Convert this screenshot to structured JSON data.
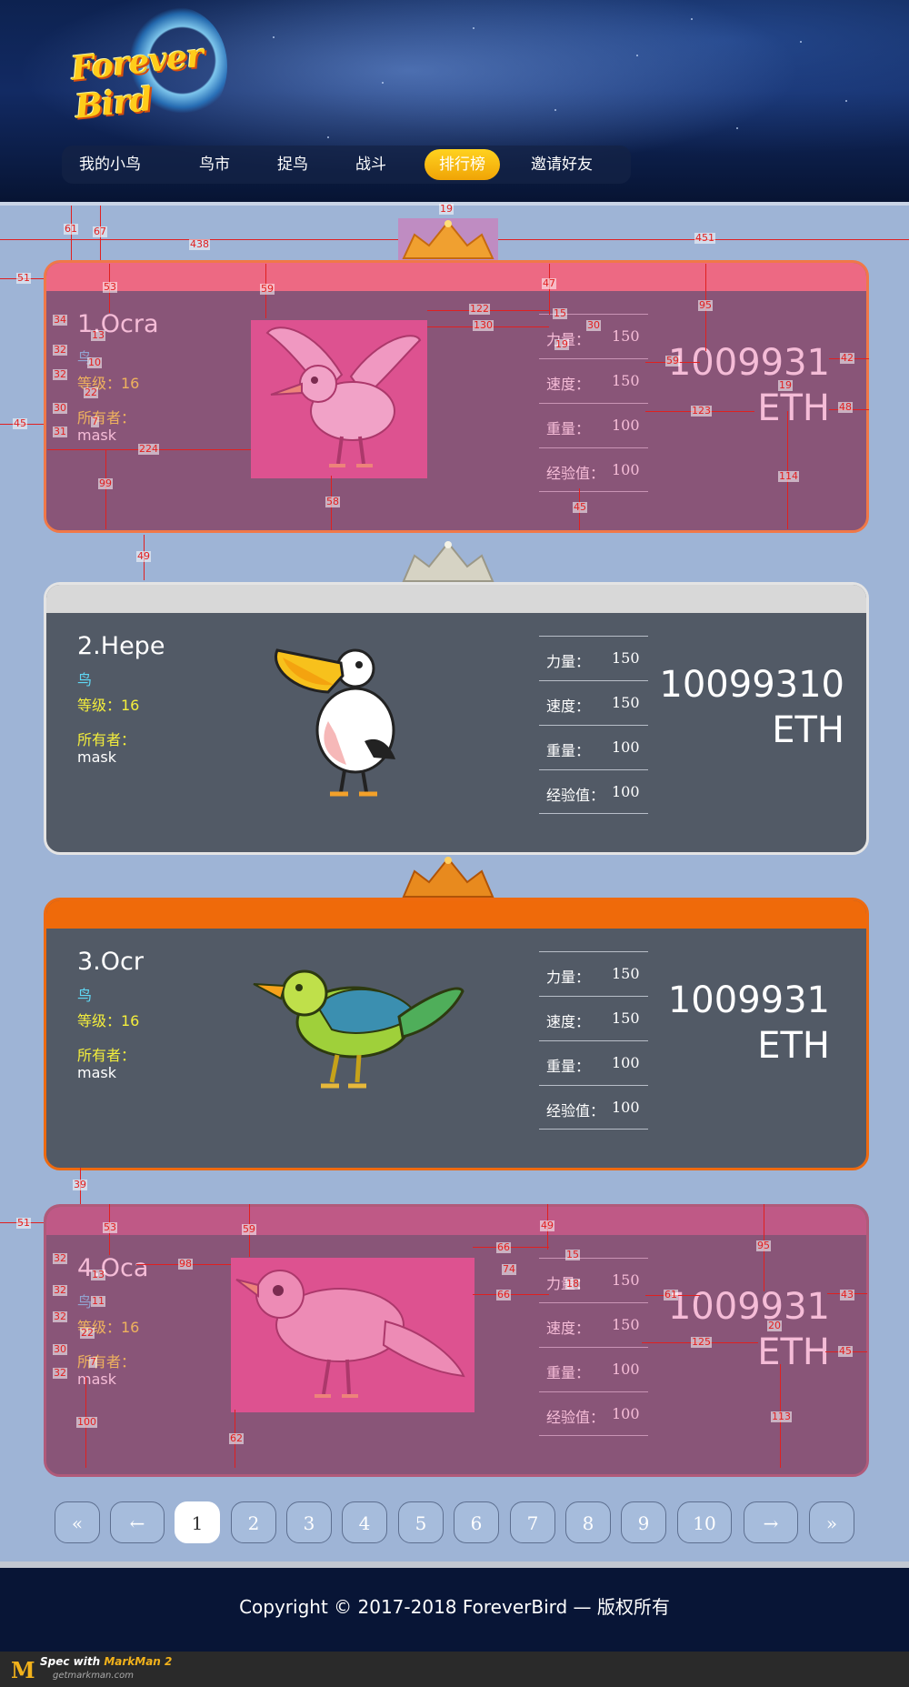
{
  "logo": {
    "text": "Forever Bird"
  },
  "nav": {
    "items": [
      {
        "label": "我的小鸟",
        "active": false
      },
      {
        "label": "鸟市",
        "active": false
      },
      {
        "label": "捉鸟",
        "active": false
      },
      {
        "label": "战斗",
        "active": false
      },
      {
        "label": "排行榜",
        "active": true
      },
      {
        "label": "邀请好友",
        "active": false
      }
    ]
  },
  "ranking": [
    {
      "rank_name": "1.Ocra",
      "kind": "鸟",
      "level": "等级：16",
      "owner_label": "所有者：",
      "owner": "mask",
      "stats": [
        {
          "label": "力量：",
          "value": "150"
        },
        {
          "label": "速度：",
          "value": "150"
        },
        {
          "label": "重量：",
          "value": "100"
        },
        {
          "label": "经验值：",
          "value": "100"
        }
      ],
      "price": "1009931",
      "unit": "ETH",
      "crown": "gold",
      "accent": "#f27a78",
      "bird_icon": "seagull-icon"
    },
    {
      "rank_name": "2.Hepe",
      "kind": "鸟",
      "level": "等级：16",
      "owner_label": "所有者：",
      "owner": "mask",
      "stats": [
        {
          "label": "力量：",
          "value": "150"
        },
        {
          "label": "速度：",
          "value": "150"
        },
        {
          "label": "重量：",
          "value": "100"
        },
        {
          "label": "经验值：",
          "value": "100"
        }
      ],
      "price": "10099310",
      "unit": "ETH",
      "crown": "silver",
      "accent": "#d8d8d8",
      "bird_icon": "pelican-icon"
    },
    {
      "rank_name": "3.Ocr",
      "kind": "鸟",
      "level": "等级：16",
      "owner_label": "所有者：",
      "owner": "mask",
      "stats": [
        {
          "label": "力量：",
          "value": "150"
        },
        {
          "label": "速度：",
          "value": "150"
        },
        {
          "label": "重量：",
          "value": "100"
        },
        {
          "label": "经验值：",
          "value": "100"
        }
      ],
      "price": "1009931",
      "unit": "ETH",
      "crown": "bronze",
      "accent": "#ef6a0a",
      "bird_icon": "green-bird-icon"
    },
    {
      "rank_name": "4.Oca",
      "kind": "鸟",
      "level": "等级：16",
      "owner_label": "所有者：",
      "owner": "mask",
      "stats": [
        {
          "label": "力量：",
          "value": "150"
        },
        {
          "label": "速度：",
          "value": "150"
        },
        {
          "label": "重量：",
          "value": "100"
        },
        {
          "label": "经验值：",
          "value": "100"
        }
      ],
      "price": "1009931",
      "unit": "ETH",
      "crown": "none",
      "accent": "#a8607c",
      "bird_icon": "sparrow-icon"
    }
  ],
  "pagination": {
    "first": "«",
    "prev": "←",
    "pages": [
      "1",
      "2",
      "3",
      "4",
      "5",
      "6",
      "7",
      "8",
      "9",
      "10"
    ],
    "current": "1",
    "next": "→",
    "last": "»"
  },
  "footer": {
    "copyright": "Copyright © 2017-2018 ForeverBird — 版权所有"
  },
  "markman": {
    "prefix": "Spec with",
    "brand": "MarkMan 2",
    "url": "getmarkman.com"
  },
  "measurements": {
    "card1": [
      "19",
      "61",
      "67",
      "438",
      "451",
      "51",
      "53",
      "59",
      "47",
      "95",
      "34",
      "13",
      "122",
      "15",
      "130",
      "30",
      "32",
      "10",
      "19",
      "32",
      "22",
      "59",
      "42",
      "45",
      "30",
      "7",
      "19",
      "31",
      "123",
      "48",
      "224",
      "99",
      "58",
      "45",
      "114"
    ],
    "between": [
      "49",
      "39"
    ],
    "card4": [
      "51",
      "53",
      "59",
      "49",
      "95",
      "32",
      "98",
      "13",
      "66",
      "15",
      "32",
      "11",
      "74",
      "18",
      "61",
      "43",
      "32",
      "22",
      "66",
      "20",
      "30",
      "7",
      "125",
      "45",
      "32",
      "100",
      "62",
      "113"
    ]
  }
}
